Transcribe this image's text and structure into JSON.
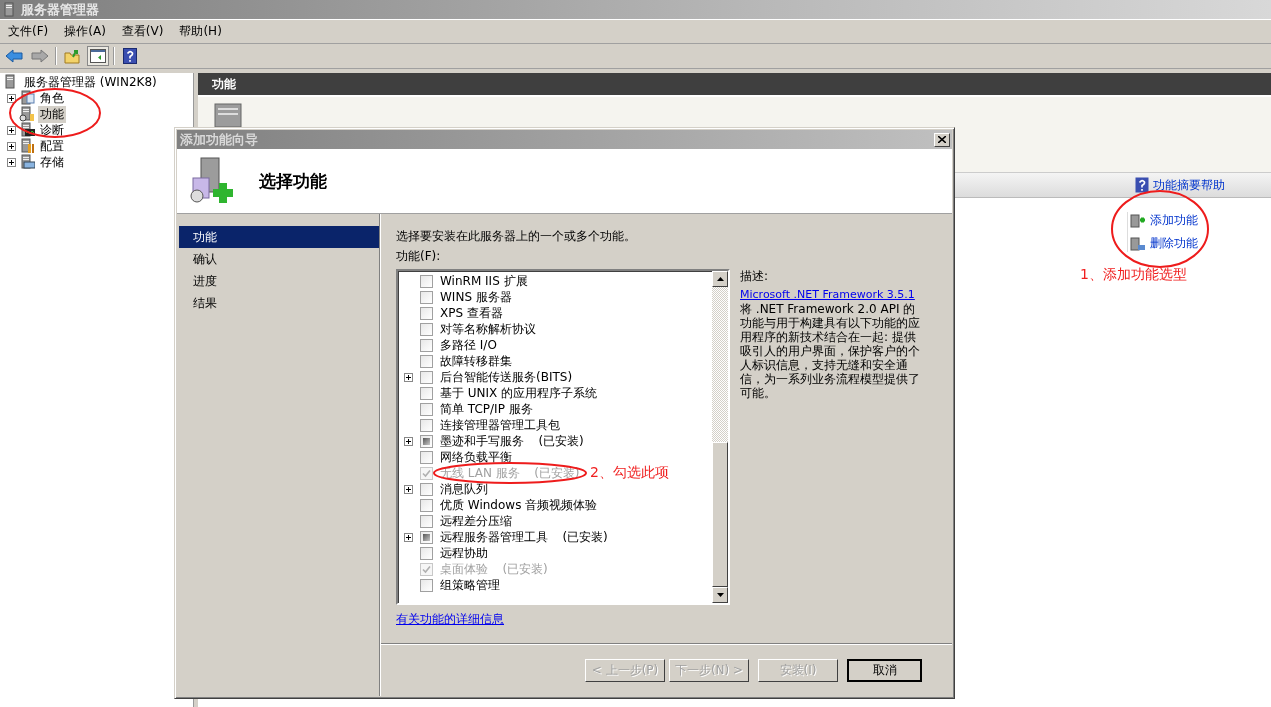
{
  "window": {
    "title": "服务器管理器"
  },
  "menu": [
    "文件(F)",
    "操作(A)",
    "查看(V)",
    "帮助(H)"
  ],
  "toolbar": [
    {
      "kind": "back",
      "disabled": false
    },
    {
      "kind": "forward",
      "disabled": true
    },
    {
      "kind": "up"
    },
    {
      "kind": "pane",
      "pressed": true
    },
    {
      "kind": "help"
    }
  ],
  "tree": {
    "label": "服务器管理器 (WIN2K8)",
    "children": [
      {
        "label": "角色",
        "expandable": true,
        "selected": false,
        "kind": "roles"
      },
      {
        "label": "功能",
        "expandable": false,
        "selected": true,
        "kind": "features"
      },
      {
        "label": "诊断",
        "expandable": true,
        "selected": false,
        "kind": "diagnostics"
      },
      {
        "label": "配置",
        "expandable": true,
        "selected": false,
        "kind": "config"
      },
      {
        "label": "存储",
        "expandable": true,
        "selected": false,
        "kind": "storage"
      }
    ]
  },
  "main": {
    "header": "功能",
    "help_link": "功能摘要帮助",
    "actions": [
      {
        "label": "添加功能",
        "kind": "add"
      },
      {
        "label": "删除功能",
        "kind": "remove"
      }
    ]
  },
  "wizard": {
    "title": "添加功能向导",
    "heading": "选择功能",
    "steps": [
      {
        "label": "功能",
        "selected": true
      },
      {
        "label": "确认",
        "selected": false
      },
      {
        "label": "进度",
        "selected": false
      },
      {
        "label": "结果",
        "selected": false
      }
    ],
    "instruction": "选择要安装在此服务器上的一个或多个功能。",
    "list_label": "功能(F):",
    "features": [
      {
        "name": "WinRM IIS 扩展",
        "checked": false,
        "partial": false,
        "disabled": false,
        "expandable": false
      },
      {
        "name": "WINS 服务器",
        "checked": false,
        "partial": false,
        "disabled": false,
        "expandable": false
      },
      {
        "name": "XPS 查看器",
        "checked": false,
        "partial": false,
        "disabled": false,
        "expandable": false
      },
      {
        "name": "对等名称解析协议",
        "checked": false,
        "partial": false,
        "disabled": false,
        "expandable": false
      },
      {
        "name": "多路径 I/O",
        "checked": false,
        "partial": false,
        "disabled": false,
        "expandable": false
      },
      {
        "name": "故障转移群集",
        "checked": false,
        "partial": false,
        "disabled": false,
        "expandable": false
      },
      {
        "name": "后台智能传送服务(BITS)",
        "checked": false,
        "partial": false,
        "disabled": false,
        "expandable": true
      },
      {
        "name": "基于 UNIX 的应用程序子系统",
        "checked": false,
        "partial": false,
        "disabled": false,
        "expandable": false
      },
      {
        "name": "简单 TCP/IP 服务",
        "checked": false,
        "partial": false,
        "disabled": false,
        "expandable": false
      },
      {
        "name": "连接管理器管理工具包",
        "checked": false,
        "partial": false,
        "disabled": false,
        "expandable": false
      },
      {
        "name": "墨迹和手写服务",
        "status": "(已安装)",
        "checked": false,
        "partial": true,
        "disabled": false,
        "expandable": true
      },
      {
        "name": "网络负载平衡",
        "checked": false,
        "partial": false,
        "disabled": false,
        "expandable": false
      },
      {
        "name": "无线 LAN 服务",
        "status": "(已安装)",
        "checked": true,
        "partial": false,
        "disabled": true,
        "expandable": false
      },
      {
        "name": "消息队列",
        "checked": false,
        "partial": false,
        "disabled": false,
        "expandable": true
      },
      {
        "name": "优质 Windows 音频视频体验",
        "checked": false,
        "partial": false,
        "disabled": false,
        "expandable": false
      },
      {
        "name": "远程差分压缩",
        "checked": false,
        "partial": false,
        "disabled": false,
        "expandable": false
      },
      {
        "name": "远程服务器管理工具",
        "status": "(已安装)",
        "checked": false,
        "partial": true,
        "disabled": false,
        "expandable": true
      },
      {
        "name": "远程协助",
        "checked": false,
        "partial": false,
        "disabled": false,
        "expandable": false
      },
      {
        "name": "桌面体验",
        "status": "(已安装)",
        "checked": true,
        "partial": false,
        "disabled": true,
        "expandable": false
      },
      {
        "name": "组策略管理",
        "checked": false,
        "partial": false,
        "disabled": false,
        "expandable": false
      }
    ],
    "description_label": "描述:",
    "description_link": "Microsoft .NET Framework 3.5.1",
    "description": "将 .NET Framework 2.0 API 的功能与用于构建具有以下功能的应用程序的新技术结合在一起: 提供吸引人的用户界面，保护客户的个人标识信息，支持无缝和安全通信，为一系列业务流程模型提供了可能。",
    "more_link": "有关功能的详细信息",
    "buttons": [
      {
        "label": "< 上一步(P)",
        "disabled": true,
        "default": false
      },
      {
        "label": "下一步(N) >",
        "disabled": true,
        "default": false
      },
      {
        "label": "安装(I)",
        "disabled": true,
        "default": false
      },
      {
        "label": "取消",
        "disabled": false,
        "default": true
      }
    ]
  },
  "annotations": [
    {
      "text": "1、添加功能选型"
    },
    {
      "text": "2、勾选此项"
    }
  ]
}
